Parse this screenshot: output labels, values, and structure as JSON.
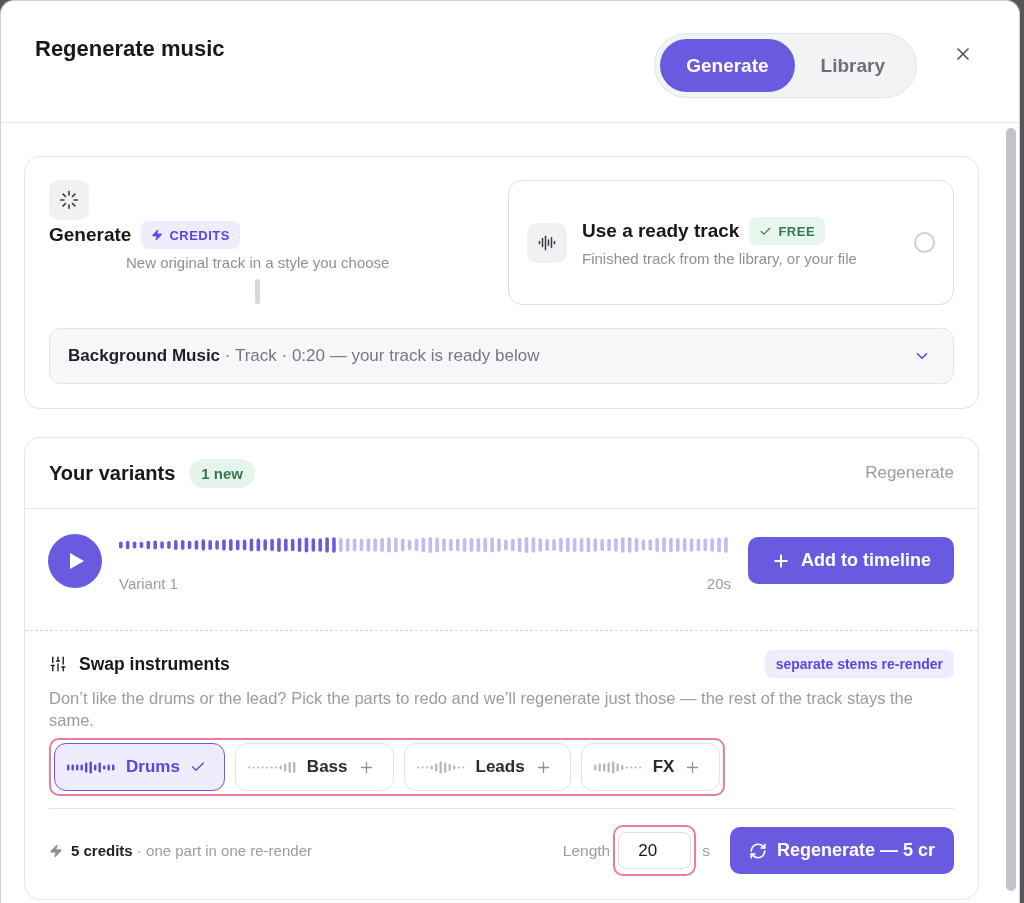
{
  "dialog": {
    "title": "Regenerate music",
    "tabs": [
      {
        "label": "Generate",
        "selected": true
      },
      {
        "label": "Library",
        "selected": false
      }
    ]
  },
  "source": {
    "generate": {
      "title": "Generate",
      "badge": "CREDITS",
      "description": "New original track in a style you choose"
    },
    "ready_track": {
      "title": "Use a ready track",
      "badge": "FREE",
      "description": "Finished track from the library, or your file",
      "selected": false
    },
    "track_select": {
      "name": "Background Music",
      "details": "· Track · 0:20 — your track is ready below"
    }
  },
  "variants": {
    "title": "Your variants",
    "badge": "1 new",
    "action": "Regenerate",
    "items": [
      {
        "label": "Variant 1",
        "duration": "20s",
        "level": 0.36,
        "button": "Add to timeline"
      }
    ]
  },
  "swap": {
    "title": "Swap instruments",
    "badge": "separate stems re-render",
    "description": "Don’t like the drums or the lead? Pick the parts to redo and we’ll regenerate just those — the rest of the track stays the same.",
    "highlighted": true,
    "stems": [
      {
        "label": "Drums",
        "selected": true
      },
      {
        "label": "Bass",
        "selected": false
      },
      {
        "label": "Leads",
        "selected": false
      },
      {
        "label": "FX",
        "selected": false
      }
    ]
  },
  "footer": {
    "credits": "**5 credits** · one part in one re-render",
    "length_label": "Length",
    "length": {
      "value": "20",
      "highlighted": true
    },
    "unit": "s",
    "button": "Regenerate — 5 cr"
  }
}
